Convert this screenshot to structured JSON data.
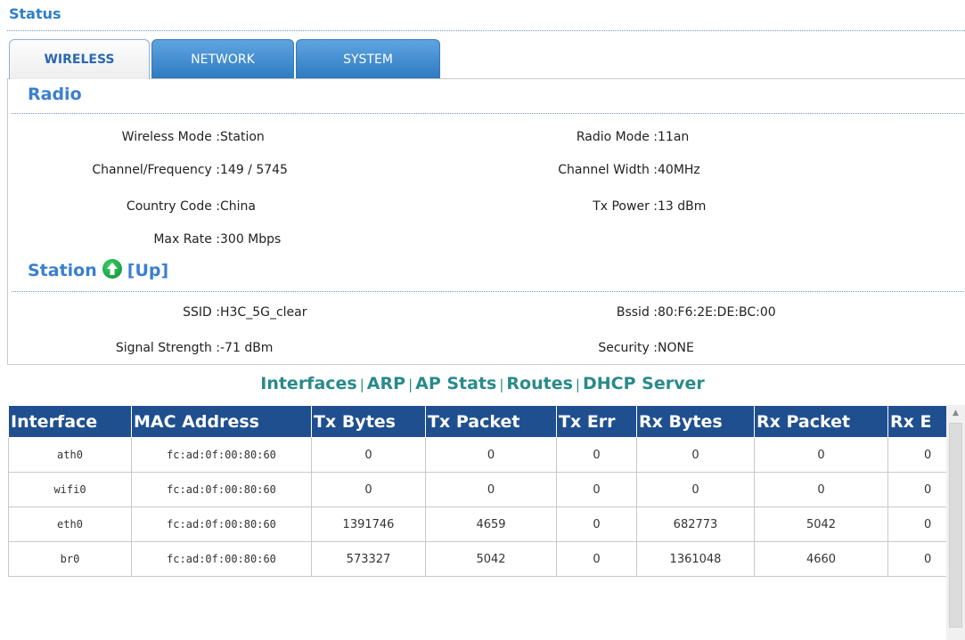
{
  "header": {
    "title": "Status"
  },
  "tabs": [
    {
      "label": "WIRELESS",
      "active": true
    },
    {
      "label": "NETWORK",
      "active": false
    },
    {
      "label": "SYSTEM",
      "active": false
    }
  ],
  "radio": {
    "title": "Radio",
    "left": [
      {
        "label": "Wireless Mode :",
        "value": "Station"
      },
      {
        "label": "Channel/Frequency :",
        "value": "149 / 5745"
      },
      {
        "label": "Country Code :",
        "value": "China"
      },
      {
        "label": "Max Rate :",
        "value": "300 Mbps"
      }
    ],
    "right": [
      {
        "label": "Radio Mode :",
        "value": "11an"
      },
      {
        "label": "Channel Width :",
        "value": "40MHz"
      },
      {
        "label": "Tx Power :",
        "value": "13 dBm"
      }
    ]
  },
  "station": {
    "title": "Station",
    "status": "[Up]",
    "status_icon": "up-arrow-icon",
    "left": [
      {
        "label": "SSID :",
        "value": "H3C_5G_clear"
      },
      {
        "label": "Signal Strength :",
        "value": "-71 dBm"
      }
    ],
    "right": [
      {
        "label": "Bssid :",
        "value": "80:F6:2E:DE:BC:00"
      },
      {
        "label": "Security :",
        "value": "NONE"
      }
    ]
  },
  "links": [
    "Interfaces",
    "ARP",
    "AP Stats",
    "Routes",
    "DHCP Server"
  ],
  "link_separator": "|",
  "table": {
    "headers": [
      "Interface",
      "MAC Address",
      "Tx Bytes",
      "Tx Packet",
      "Tx Err",
      "Rx Bytes",
      "Rx Packet",
      "Rx E"
    ],
    "rows": [
      [
        "ath0",
        "fc:ad:0f:00:80:60",
        "0",
        "0",
        "0",
        "0",
        "0",
        "0"
      ],
      [
        "wifi0",
        "fc:ad:0f:00:80:60",
        "0",
        "0",
        "0",
        "0",
        "0",
        "0"
      ],
      [
        "eth0",
        "fc:ad:0f:00:80:60",
        "1391746",
        "4659",
        "0",
        "682773",
        "5042",
        "0"
      ],
      [
        "br0",
        "fc:ad:0f:00:80:60",
        "573327",
        "5042",
        "0",
        "1361048",
        "4660",
        "0"
      ]
    ]
  },
  "colors": {
    "accent": "#3a7fcf",
    "table_header": "#1f4f8f",
    "links": "#2a8a8a",
    "status_up": "#1aa846"
  }
}
